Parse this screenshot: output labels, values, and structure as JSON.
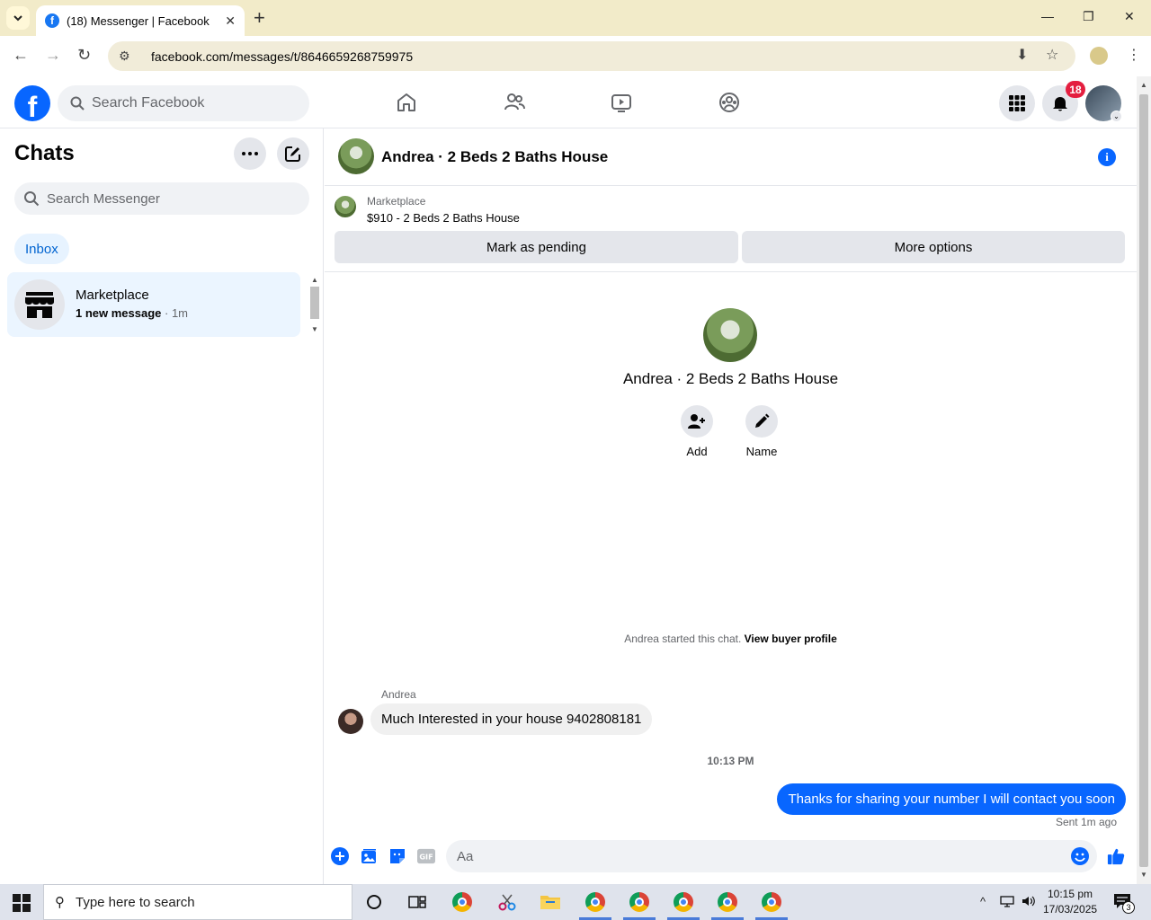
{
  "browser": {
    "tab_title": "(18) Messenger | Facebook",
    "url": "facebook.com/messages/t/8646659268759975"
  },
  "fb": {
    "search_placeholder": "Search Facebook",
    "notification_count": "18"
  },
  "sidebar": {
    "title": "Chats",
    "search_placeholder": "Search Messenger",
    "filter": "Inbox",
    "chats": [
      {
        "name": "Marketplace",
        "preview": "1 new message",
        "time": " · 1m"
      }
    ]
  },
  "conversation": {
    "title": "Andrea · 2 Beds 2 Baths House",
    "marketplace_label": "Marketplace",
    "listing": "$910 - 2 Beds 2 Baths House",
    "mark_pending": "Mark as pending",
    "more_options": "More options",
    "profile_name": "Andrea · 2 Beds 2 Baths House",
    "add_label": "Add",
    "name_label": "Name",
    "started_text": "Andrea started this chat. ",
    "buyer_profile_link": "View buyer profile",
    "messages": [
      {
        "sender": "Andrea",
        "text": "Much Interested in your house 9402808181"
      }
    ],
    "timestamp": "10:13 PM",
    "outgoing": "Thanks for sharing your number I will contact you soon",
    "sent_status": "Sent 1m ago",
    "composer_placeholder": "Aa"
  },
  "taskbar": {
    "search_placeholder": "Type here to search",
    "time": "10:15 pm",
    "date": "17/03/2025",
    "notification_count": "3"
  },
  "colors": {
    "fb_blue": "#0866ff",
    "badge_red": "#e41e3f",
    "selected_chat": "#ebf5ff"
  }
}
